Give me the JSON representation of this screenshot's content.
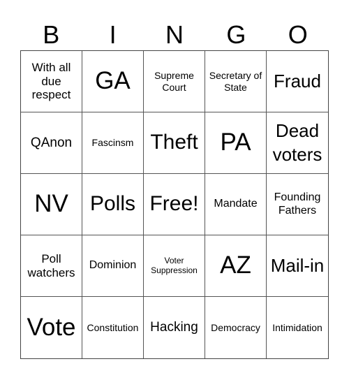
{
  "header": {
    "letters": [
      "B",
      "I",
      "N",
      "G",
      "O"
    ]
  },
  "cells": [
    "With all due respect",
    "GA",
    "Supreme Court",
    "Secretary of State",
    "Fraud",
    "QAnon",
    "Fascinsm",
    "Theft",
    "PA",
    "Dead voters",
    "NV",
    "Polls",
    "Free!",
    "Mandate",
    "Founding Fathers",
    "Poll watchers",
    "Dominion",
    "Voter Suppression",
    "AZ",
    "Mail-in",
    "Vote",
    "Constitution",
    "Hacking",
    "Democracy",
    "Intimidation"
  ]
}
